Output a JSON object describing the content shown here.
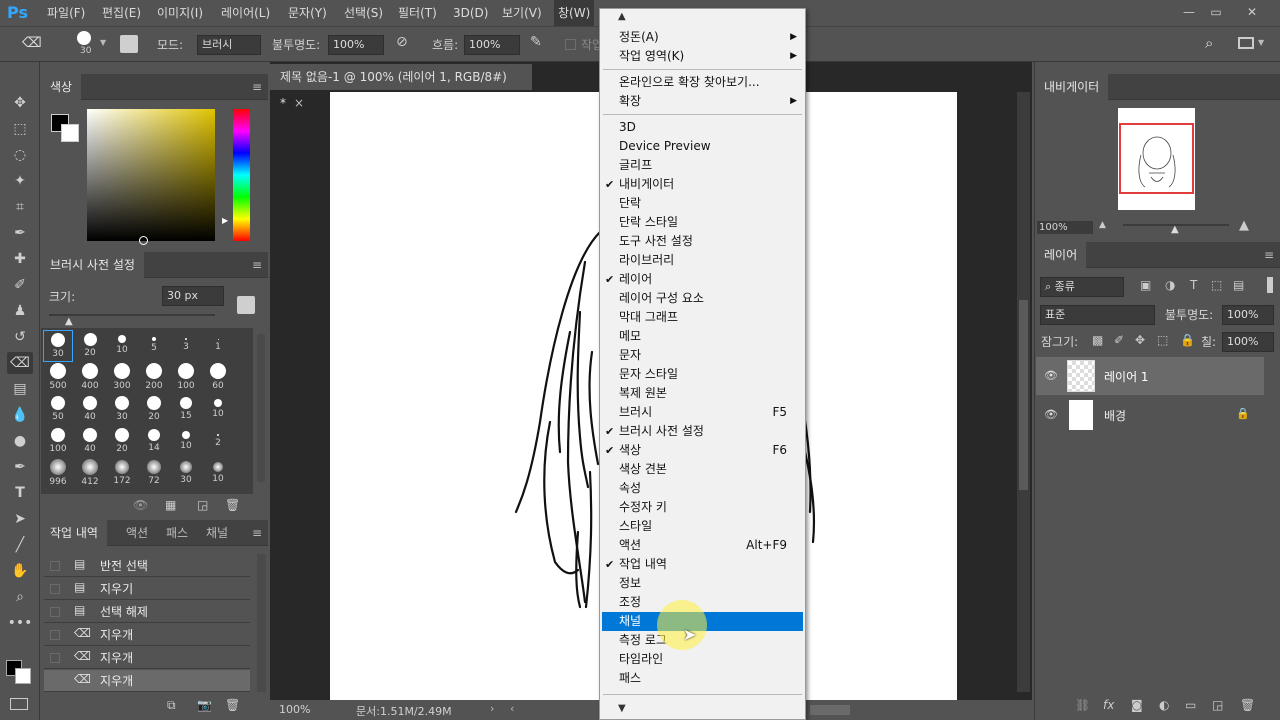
{
  "app": {
    "logo": "Ps"
  },
  "menubar": {
    "items": [
      "파일(F)",
      "편집(E)",
      "이미지(I)",
      "레이어(L)",
      "문자(Y)",
      "선택(S)",
      "필터(T)",
      "3D(D)",
      "보기(V)",
      "창(W)"
    ],
    "window_controls": [
      "—",
      "▭",
      "✕"
    ]
  },
  "options": {
    "brush_size": "30",
    "mode_label": "모드:",
    "mode_value": "브러시",
    "opacity_label": "불투명도:",
    "opacity_value": "100%",
    "flow_label": "흐름:",
    "flow_value": "100%",
    "cut_label": "작업"
  },
  "color_panel": {
    "tab": "색상"
  },
  "brush_preset_panel": {
    "tab": "브러시 사전 설정",
    "size_label": "크기:",
    "size_value": "30 px",
    "brushes": [
      [
        "30",
        "20",
        "10",
        "5",
        "3",
        "1"
      ],
      [
        "500",
        "400",
        "300",
        "200",
        "100",
        "60"
      ],
      [
        "50",
        "40",
        "30",
        "20",
        "15",
        "10"
      ],
      [
        "100",
        "40",
        "20",
        "14",
        "10",
        "2"
      ],
      [
        "996",
        "412",
        "172",
        "72",
        "30",
        "10"
      ]
    ]
  },
  "history_panel": {
    "tabs": [
      "작업 내역",
      "액션",
      "패스",
      "채널"
    ],
    "items": [
      "반전 선택",
      "지우기",
      "선택 해제",
      "지우개",
      "지우개",
      "지우개"
    ]
  },
  "document": {
    "tab_title": "제목 없음-1 @ 100% (레이어 1, RGB/8#) *",
    "zoom": "100%",
    "doc_info": "문서:1.51M/2.49M"
  },
  "window_menu": {
    "top_arrow": "▲",
    "bottom_arrow": "▼",
    "group1": [
      {
        "label": "정돈(A)",
        "submenu": true
      },
      {
        "label": "작업 영역(K)",
        "submenu": true
      }
    ],
    "group2": [
      {
        "label": "온라인으로 확장 찾아보기..."
      },
      {
        "label": "확장",
        "submenu": true
      }
    ],
    "group3": [
      {
        "label": "3D"
      },
      {
        "label": "Device Preview"
      },
      {
        "label": "글리프"
      },
      {
        "label": "내비게이터",
        "checked": true
      },
      {
        "label": "단락"
      },
      {
        "label": "단락 스타일"
      },
      {
        "label": "도구 사전 설정"
      },
      {
        "label": "라이브러리"
      },
      {
        "label": "레이어",
        "checked": true
      },
      {
        "label": "레이어 구성 요소"
      },
      {
        "label": "막대 그래프"
      },
      {
        "label": "메모"
      },
      {
        "label": "문자"
      },
      {
        "label": "문자 스타일"
      },
      {
        "label": "복제 원본"
      },
      {
        "label": "브러시",
        "shortcut": "F5"
      },
      {
        "label": "브러시 사전 설정",
        "checked": true
      },
      {
        "label": "색상",
        "checked": true,
        "shortcut": "F6"
      },
      {
        "label": "색상 견본"
      },
      {
        "label": "속성"
      },
      {
        "label": "수정자 키"
      },
      {
        "label": "스타일"
      },
      {
        "label": "액션",
        "shortcut": "Alt+F9"
      },
      {
        "label": "작업 내역",
        "checked": true
      },
      {
        "label": "정보"
      },
      {
        "label": "조정"
      },
      {
        "label": "채널",
        "highlighted": true
      },
      {
        "label": "측정 로그"
      },
      {
        "label": "타임라인"
      },
      {
        "label": "패스"
      }
    ]
  },
  "navigator_panel": {
    "tab": "내비게이터",
    "zoom": "100%"
  },
  "layers_panel": {
    "tab": "레이어",
    "filter_kind": "종류",
    "blend_mode": "표준",
    "opacity_label": "불투명도:",
    "opacity_value": "100%",
    "lock_label": "잠그기:",
    "fill_label": "칠:",
    "fill_value": "100%",
    "layers": [
      {
        "name": "레이어 1",
        "selected": true,
        "locked": false
      },
      {
        "name": "배경",
        "selected": false,
        "locked": true
      }
    ]
  },
  "colors": {
    "accent": "#0078d7",
    "ps_blue": "#31a8ff",
    "panel_bg": "#535353"
  }
}
